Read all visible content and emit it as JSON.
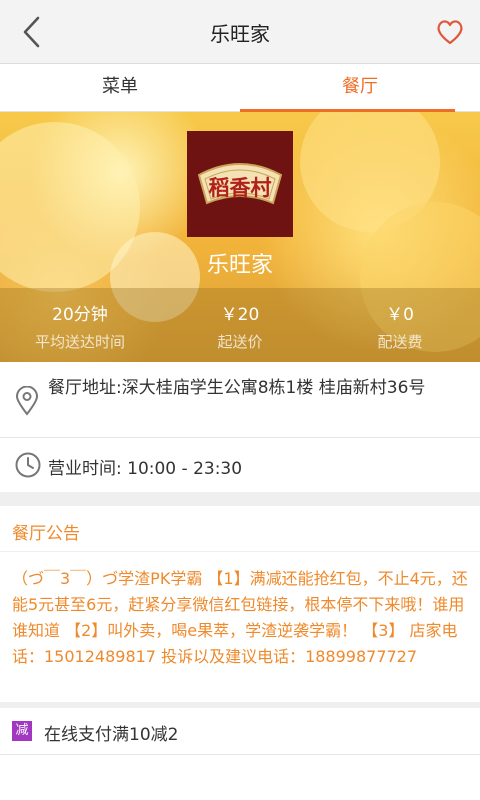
{
  "header": {
    "title": "乐旺家",
    "back_icon": "back-arrow-icon",
    "favorite_icon": "heart-icon"
  },
  "tabs": [
    {
      "label": "菜单",
      "active": false
    },
    {
      "label": "餐厅",
      "active": true
    }
  ],
  "accent_color": "#ef6d24",
  "restaurant": {
    "logo_text": "稻香村",
    "name": "乐旺家",
    "stats": [
      {
        "value": "20分钟",
        "label": "平均送达时间"
      },
      {
        "value": "￥20",
        "label": "起送价"
      },
      {
        "value": "￥0",
        "label": "配送费"
      }
    ]
  },
  "info": {
    "address": "餐厅地址:深大桂庙学生公寓8栋1楼 桂庙新村36号",
    "hours": "营业时间: 10:00 - 23:30"
  },
  "notice": {
    "title": "餐厅公告",
    "body": "（づ￣3￣）づ学渣PK学霸 【1】满减还能抢红包，不止4元，还能5元甚至6元，赶紧分享微信红包链接，根本停不下来哦！谁用谁知道 【2】叫外卖，喝e果萃，学渣逆袭学霸！ 【3】 店家电话：15012489817 投诉以及建议电话：18899877727"
  },
  "promotion": {
    "badge": "减",
    "text": "在线支付满10减2"
  }
}
